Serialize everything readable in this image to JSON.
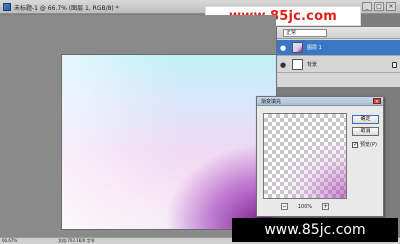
{
  "window": {
    "title": "未标题-1 @ 66.7% (图层 1, RGB/8) *",
    "min_label": "_",
    "max_label": "□",
    "close_label": "×"
  },
  "watermark": {
    "top_text": "www.85jc.com",
    "bottom_text": "www.85jc.com"
  },
  "layers": {
    "blend_mode": "正常",
    "items": [
      {
        "name": "图层 1",
        "active": true
      },
      {
        "name": "背景",
        "active": false,
        "locked": true
      }
    ]
  },
  "dialog": {
    "title": "渐变填充",
    "ok_label": "确定",
    "cancel_label": "取消",
    "preview_label": "预览(P)",
    "preview_checked": true,
    "zoom_value": "100%",
    "zoom_out": "−",
    "zoom_in": "+"
  },
  "status": {
    "zoom": "66.67%",
    "info": "文档:703.1K/0 字节"
  }
}
